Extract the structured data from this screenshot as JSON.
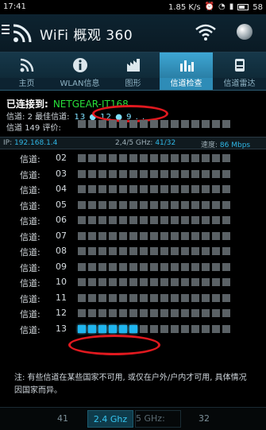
{
  "status_bar": {
    "time": "17:41",
    "speed": "1.85",
    "speed_unit": "K/s",
    "battery": "58"
  },
  "app_bar": {
    "title": "WiFi 概观 360"
  },
  "tabs": [
    {
      "label": "主页",
      "icon": "wifi-signal-icon"
    },
    {
      "label": "WLAN信息",
      "icon": "info-icon"
    },
    {
      "label": "图形",
      "icon": "factory-graph-icon"
    },
    {
      "label": "信道检查",
      "icon": "bar-chart-icon",
      "active": true
    },
    {
      "label": "信道雷达",
      "icon": "radar-icon"
    }
  ],
  "connection": {
    "connected_label": "已连接到:",
    "ssid": "NETGEAR-IT168",
    "channel_label": "信道:",
    "channel": "2",
    "best_label": "最佳信道:",
    "best_channels": "13 ● 12 ● 9 . .",
    "channel_line3_label": "信道",
    "channel3": "149",
    "score_label": "评价:"
  },
  "info_bar": {
    "ip_label": "IP:",
    "ip": "192.168.1.4",
    "band": "2,4/5 GHz:",
    "band_value": "41/32",
    "speed_label": "速度:",
    "speed": "86 Mbps"
  },
  "channels": {
    "label": "信道:",
    "rows": [
      {
        "num": "02",
        "level": 0
      },
      {
        "num": "03",
        "level": 0
      },
      {
        "num": "04",
        "level": 0
      },
      {
        "num": "05",
        "level": 0
      },
      {
        "num": "06",
        "level": 0
      },
      {
        "num": "07",
        "level": 0
      },
      {
        "num": "08",
        "level": 0
      },
      {
        "num": "09",
        "level": 0
      },
      {
        "num": "10",
        "level": 0
      },
      {
        "num": "11",
        "level": 0
      },
      {
        "num": "12",
        "level": 0
      },
      {
        "num": "13",
        "level": 6
      }
    ]
  },
  "note": "注: 有些信道在某些国家不可用, 或仅在户外/户内才可用, 具体情况因国家而异。",
  "bottom_bar": {
    "count_24": "41",
    "band_24": "2.4 Ghz",
    "band_5": "5 GHz:",
    "count_5": "32"
  },
  "colors": {
    "accent": "#2e8cb7",
    "ssid": "#28e03a",
    "active_bar": "#1fb6f0",
    "highlight_ring": "#e0191f"
  }
}
